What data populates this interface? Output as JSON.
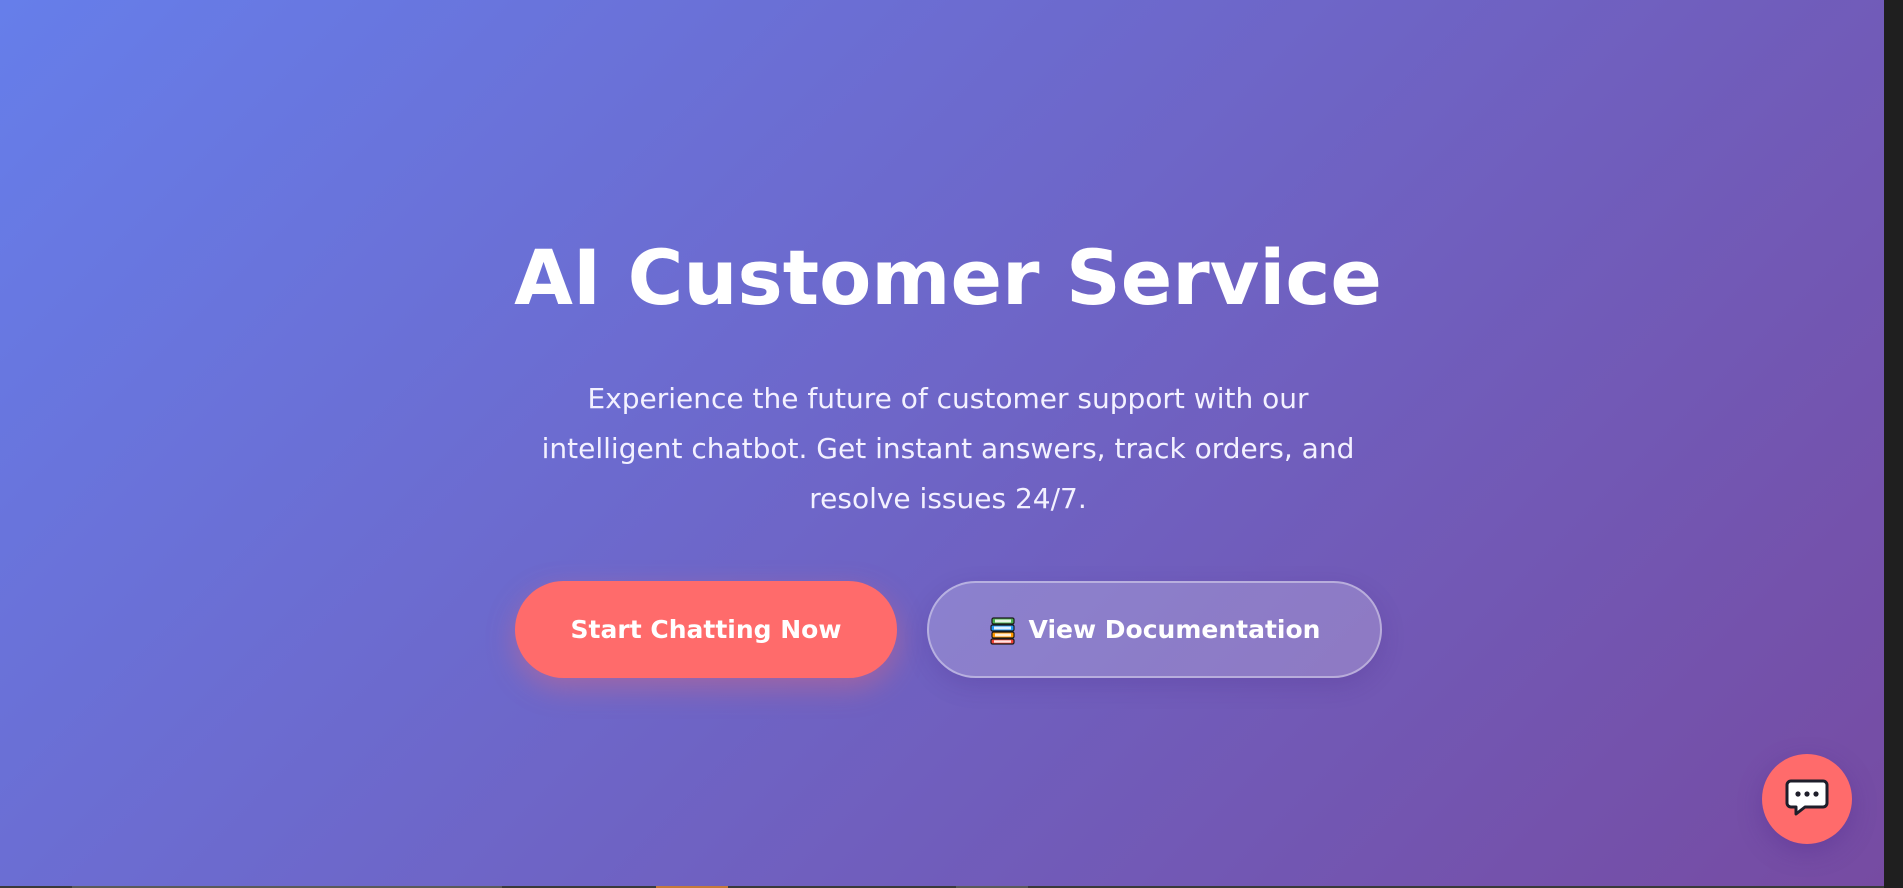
{
  "hero": {
    "title": "AI Customer Service",
    "subtitle": "Experience the future of customer support with our intelligent chatbot. Get instant answers, track orders, and resolve issues 24/7."
  },
  "actions": {
    "primary_label": "Start Chatting Now",
    "secondary_label": "View Documentation",
    "secondary_icon": "books-icon"
  },
  "chat_widget": {
    "icon": "chat-bubble-icon"
  },
  "colors": {
    "gradient_start": "#667eea",
    "gradient_end": "#764ba2",
    "accent": "#ff6b6b",
    "text": "#ffffff"
  }
}
